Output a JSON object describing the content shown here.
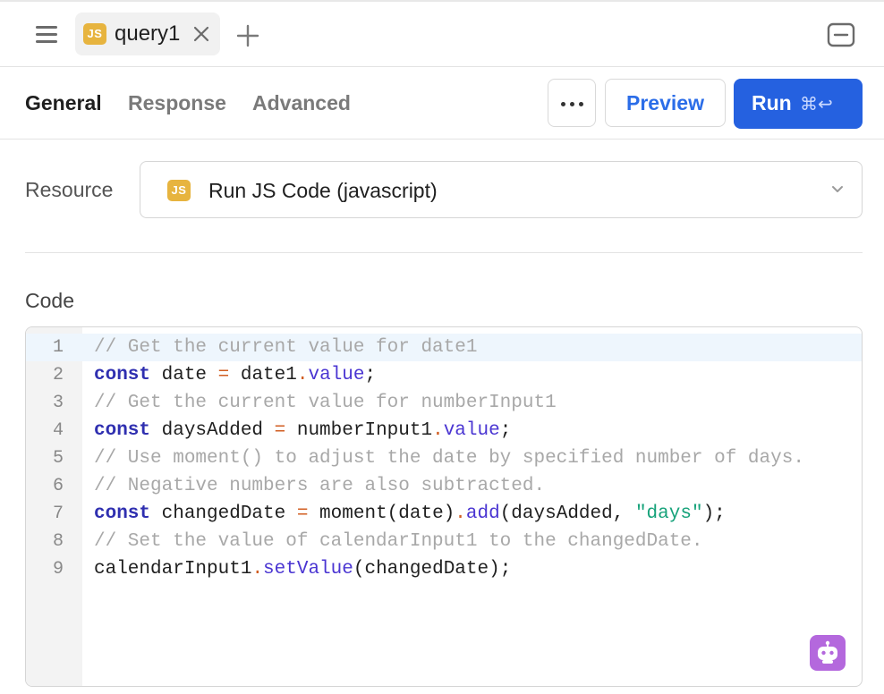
{
  "tabs": [
    {
      "badge": "JS",
      "label": "query1",
      "active": true
    }
  ],
  "sub_tabs": [
    {
      "label": "General",
      "active": true
    },
    {
      "label": "Response",
      "active": false
    },
    {
      "label": "Advanced",
      "active": false
    }
  ],
  "toolbar": {
    "more_label": "•••",
    "preview_label": "Preview",
    "run_label": "Run",
    "run_shortcut": "⌘↩"
  },
  "resource": {
    "label": "Resource",
    "badge": "JS",
    "value": "Run JS Code (javascript)"
  },
  "code_section": {
    "label": "Code",
    "active_line": 1,
    "lines": [
      {
        "n": "1",
        "tokens": [
          {
            "t": "// Get the current value for date1",
            "k": "comment"
          }
        ]
      },
      {
        "n": "2",
        "tokens": [
          {
            "t": "const",
            "k": "keyword"
          },
          {
            "t": " date ",
            "k": "plain"
          },
          {
            "t": "=",
            "k": "operator"
          },
          {
            "t": " date1",
            "k": "plain"
          },
          {
            "t": ".",
            "k": "operator"
          },
          {
            "t": "value",
            "k": "property"
          },
          {
            "t": ";",
            "k": "plain"
          }
        ]
      },
      {
        "n": "3",
        "tokens": [
          {
            "t": "// Get the current value for numberInput1",
            "k": "comment"
          }
        ]
      },
      {
        "n": "4",
        "tokens": [
          {
            "t": "const",
            "k": "keyword"
          },
          {
            "t": " daysAdded ",
            "k": "plain"
          },
          {
            "t": "=",
            "k": "operator"
          },
          {
            "t": " numberInput1",
            "k": "plain"
          },
          {
            "t": ".",
            "k": "operator"
          },
          {
            "t": "value",
            "k": "property"
          },
          {
            "t": ";",
            "k": "plain"
          }
        ]
      },
      {
        "n": "5",
        "tokens": [
          {
            "t": "// Use moment() to adjust the date by specified number of days.",
            "k": "comment"
          }
        ]
      },
      {
        "n": "6",
        "tokens": [
          {
            "t": "// Negative numbers are also subtracted.",
            "k": "comment"
          }
        ]
      },
      {
        "n": "7",
        "tokens": [
          {
            "t": "const",
            "k": "keyword"
          },
          {
            "t": " changedDate ",
            "k": "plain"
          },
          {
            "t": "=",
            "k": "operator"
          },
          {
            "t": " moment(date)",
            "k": "plain"
          },
          {
            "t": ".",
            "k": "operator"
          },
          {
            "t": "add",
            "k": "property"
          },
          {
            "t": "(daysAdded, ",
            "k": "plain"
          },
          {
            "t": "\"days\"",
            "k": "string"
          },
          {
            "t": ");",
            "k": "plain"
          }
        ]
      },
      {
        "n": "8",
        "tokens": [
          {
            "t": "// Set the value of calendarInput1 to the changedDate.",
            "k": "comment"
          }
        ]
      },
      {
        "n": "9",
        "tokens": [
          {
            "t": "calendarInput1",
            "k": "plain"
          },
          {
            "t": ".",
            "k": "operator"
          },
          {
            "t": "setValue",
            "k": "property"
          },
          {
            "t": "(changedDate);",
            "k": "plain"
          }
        ]
      }
    ]
  },
  "icons": {
    "menu": "hamburger-icon",
    "tab_close": "close-icon",
    "add_tab": "plus-icon",
    "collapse": "minimize-icon",
    "chevron": "chevron-down-icon",
    "assistant": "robot-icon"
  },
  "colors": {
    "accent": "#2561e0",
    "js_badge": "#e7b43f",
    "assistant": "#b468dd"
  }
}
